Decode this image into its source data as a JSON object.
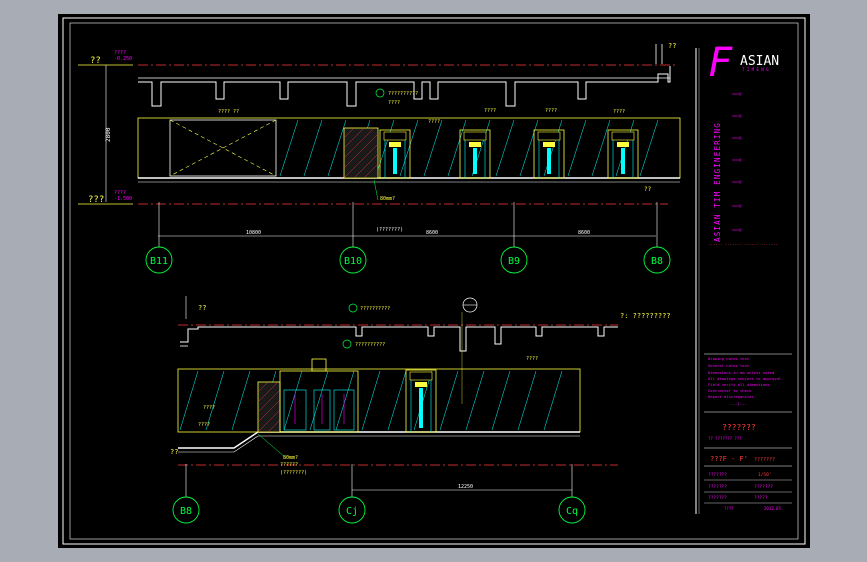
{
  "colors": {
    "frame": "#a7acb5",
    "paper": "#000000",
    "border": "#ffffff",
    "dim": "#ff3b3b",
    "line": "#ffffff",
    "yellow": "#ffff40",
    "cyan": "#00ffff",
    "green": "#00ff40",
    "magenta": "#ff00ff",
    "grid": "#00ff00"
  },
  "upper": {
    "level_top": "??",
    "level_top_val": "????",
    "level_top_val2": "-0.250",
    "level_bottom": "???",
    "level_bottom_val": "????",
    "level_bottom_val2": "-1.500",
    "height_dim": "2800",
    "callouts": [
      "??????????",
      "????",
      "????",
      "????",
      "????",
      "???? ??",
      "????"
    ],
    "note_main": "??????",
    "note_80": "80mm?",
    "note_right": "??",
    "dims": [
      "10800",
      "8600",
      "8600"
    ],
    "dim_note": "(???????)",
    "axes": [
      "B11",
      "B10",
      "B9",
      "B8"
    ]
  },
  "lower": {
    "level_top": "??",
    "title_label": "?: ?????????",
    "callouts": [
      "??????????",
      "??????????",
      "????",
      "????",
      "????"
    ],
    "level_bottom": "??",
    "note_80": "80mm?",
    "note_sub": "??????",
    "note_dim": "(???????)",
    "dims": [
      "12250"
    ],
    "axes": [
      "B8",
      "Cj",
      "Cq"
    ]
  },
  "titleblock": {
    "logo_letter": "F",
    "logo_text": "ASIAN",
    "logo_sub": "T I M   E N G",
    "vertical_text": "ASIAN TIM ENGINEERING",
    "small_red": "------  -------  ------  -------",
    "notes": [
      "Drawing notes text",
      "General notes text",
      "Dimensions in mm unless noted",
      "All drawings subject to approval",
      "Field verify all dimensions",
      "Contractor to check",
      "Report discrepancies"
    ],
    "note_sep": "---?---",
    "drawing_title": "???????",
    "drawing_sub": "?? ??????? ???",
    "section_label": "???F - F'",
    "section_val": "???????",
    "rows": [
      {
        "a": "???????",
        "b": "1/50'"
      },
      {
        "a": "???????",
        "b": "???????"
      },
      {
        "a": "???????",
        "b": "?????"
      },
      {
        "a": "???????",
        "b": "?????"
      }
    ],
    "foot_left": "????",
    "foot_right": "2012.05"
  }
}
